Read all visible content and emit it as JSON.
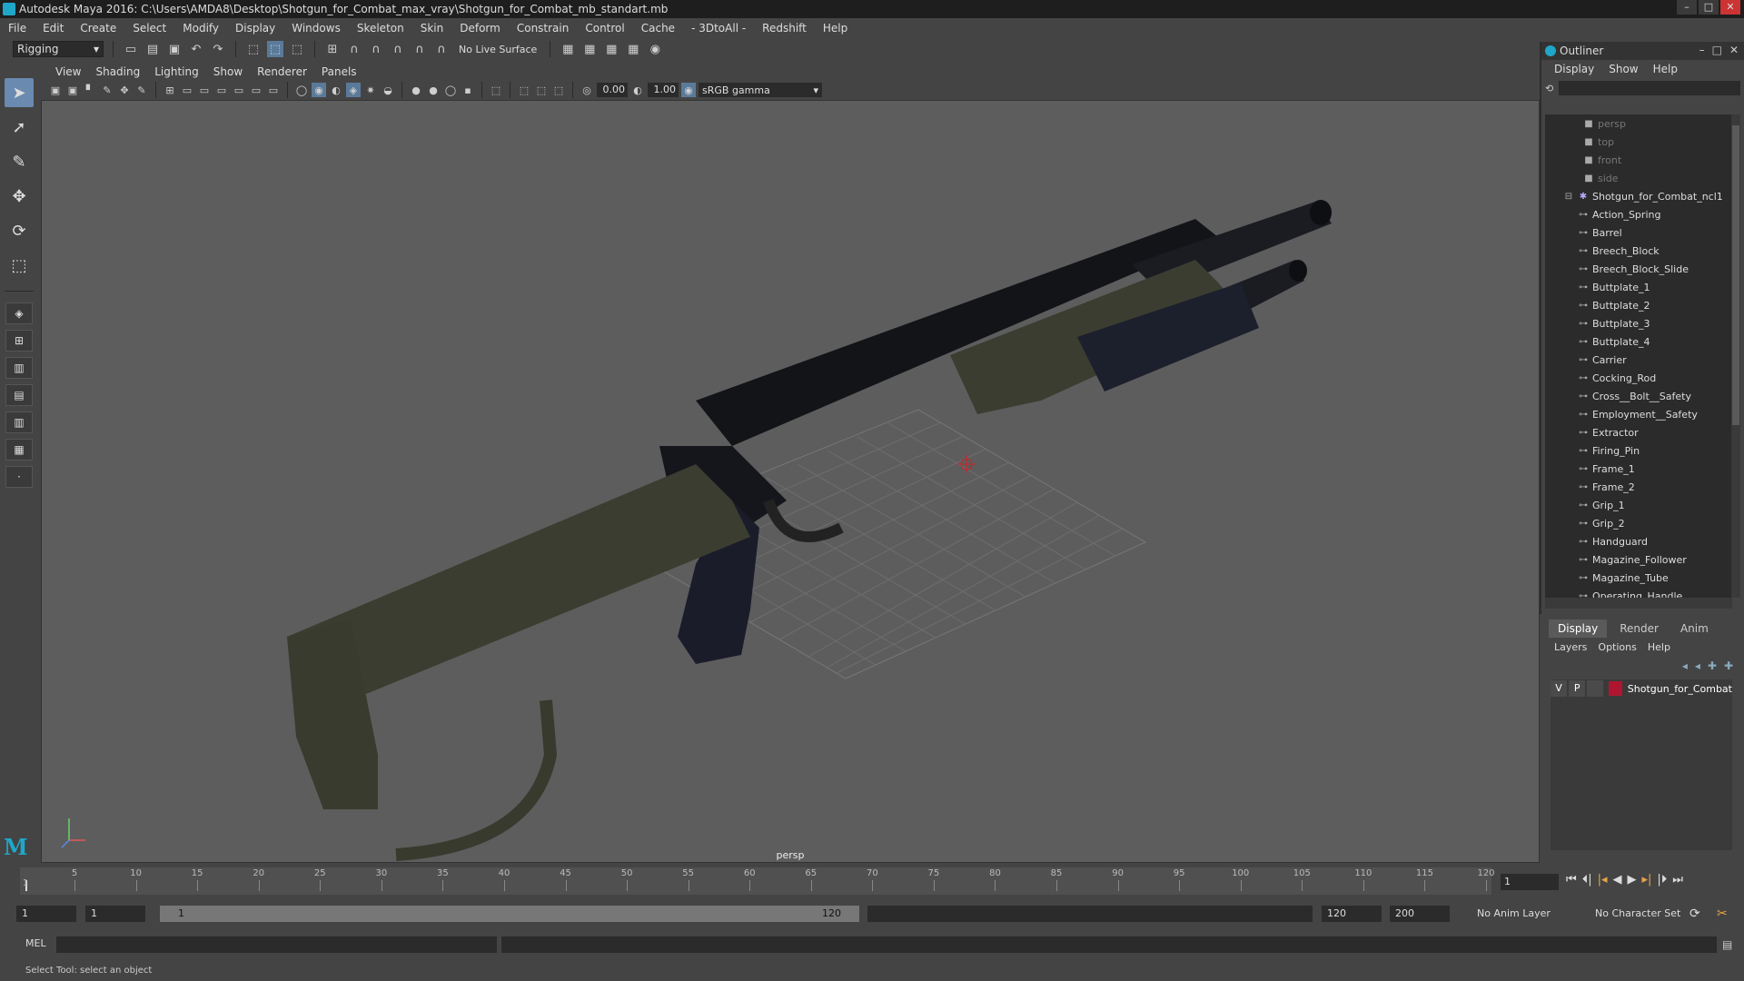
{
  "window": {
    "title": "Autodesk Maya 2016: C:\\Users\\AMDA8\\Desktop\\Shotgun_for_Combat_max_vray\\Shotgun_for_Combat_mb_standart.mb"
  },
  "menubar": {
    "items": [
      "File",
      "Edit",
      "Create",
      "Select",
      "Modify",
      "Display",
      "Windows",
      "Skeleton",
      "Skin",
      "Deform",
      "Constrain",
      "Control",
      "Cache",
      "- 3DtoAll -",
      "Redshift",
      "Help"
    ]
  },
  "statusline": {
    "mode": "Rigging",
    "live_surface": "No Live Surface"
  },
  "viewport": {
    "menu": [
      "View",
      "Shading",
      "Lighting",
      "Show",
      "Renderer",
      "Panels"
    ],
    "field_a": "0.00",
    "field_b": "1.00",
    "gamma": "sRGB gamma",
    "camera_label": "persp"
  },
  "outliner": {
    "title": "Outliner",
    "menu": [
      "Display",
      "Show",
      "Help"
    ],
    "cameras": [
      "persp",
      "top",
      "front",
      "side"
    ],
    "group": "Shotgun_for_Combat_ncl1",
    "children": [
      "Action_Spring",
      "Barrel",
      "Breech_Block",
      "Breech_Block_Slide",
      "Buttplate_1",
      "Buttplate_2",
      "Buttplate_3",
      "Buttplate_4",
      "Carrier",
      "Cocking_Rod",
      "Cross__Bolt__Safety",
      "Employment__Safety",
      "Extractor",
      "Firing_Pin",
      "Frame_1",
      "Frame_2",
      "Grip_1",
      "Grip_2",
      "Handguard",
      "Magazine_Follower",
      "Magazine_Tube",
      "Operating_Handle"
    ]
  },
  "layers": {
    "tabs": [
      "Display",
      "Render",
      "Anim"
    ],
    "menu": [
      "Layers",
      "Options",
      "Help"
    ],
    "row": {
      "v": "V",
      "p": "P",
      "name": "Shotgun_for_Combat",
      "color": "#b01530"
    }
  },
  "timeslider": {
    "ticks": [
      "5",
      "10",
      "15",
      "20",
      "25",
      "30",
      "35",
      "40",
      "45",
      "50",
      "55",
      "60",
      "65",
      "70",
      "75",
      "80",
      "85",
      "90",
      "95",
      "100",
      "105",
      "110",
      "115",
      "120"
    ],
    "start_label": "1",
    "current_frame": "1"
  },
  "range": {
    "start": "1",
    "start2": "1",
    "slider_start": "1",
    "slider_end": "120",
    "end": "120",
    "end2": "200",
    "anim_layer": "No Anim Layer",
    "character_set": "No Character Set"
  },
  "cmdline": {
    "label": "MEL"
  },
  "helpline": {
    "text": "Select Tool: select an object"
  },
  "colors": {
    "accent": "#1fa7c9",
    "active_tool": "#6a8ab0"
  },
  "icons": [
    "select-arrow-icon",
    "lasso-icon",
    "paint-select-icon",
    "move-icon",
    "rotate-icon",
    "scale-icon"
  ]
}
